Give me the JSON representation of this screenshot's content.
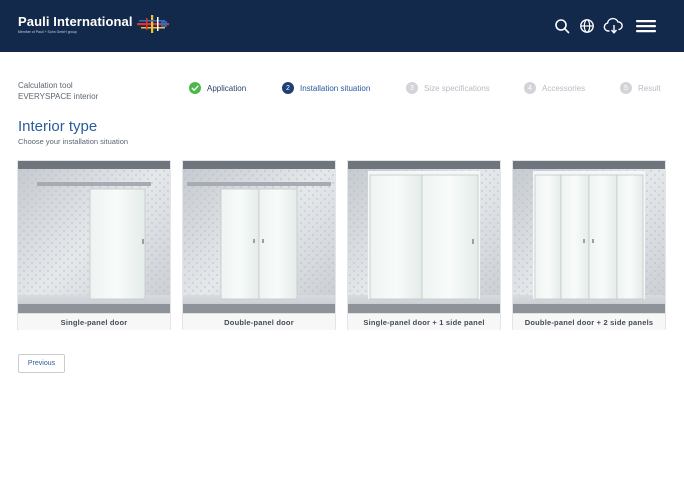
{
  "brand": {
    "name": "Pauli International",
    "tagline": "Member of Pauli + Sohn GmbH group",
    "header_bg": "#13294b"
  },
  "header_icons": [
    {
      "name": "search-icon"
    },
    {
      "name": "globe-icon"
    },
    {
      "name": "cloud-download-icon"
    },
    {
      "name": "menu-icon"
    }
  ],
  "calculation": {
    "line1": "Calculation tool",
    "line2": "EVERYSPACE interior"
  },
  "steps": [
    {
      "number": "✓",
      "label": "Application",
      "state": "done"
    },
    {
      "number": "2",
      "label": "Installation situation",
      "state": "active"
    },
    {
      "number": "3",
      "label": "Size specifications",
      "state": "future"
    },
    {
      "number": "4",
      "label": "Accessories",
      "state": "future"
    },
    {
      "number": "5",
      "label": "Result",
      "state": "future"
    }
  ],
  "page": {
    "title": "Interior type",
    "subtitle": "Choose your installation situation"
  },
  "options": [
    {
      "label": "Single-panel door"
    },
    {
      "label": "Double-panel door"
    },
    {
      "label": "Single-panel door + 1 side panel"
    },
    {
      "label": "Double-panel door + 2 side panels"
    }
  ],
  "nav": {
    "previous_label": "Previous"
  },
  "colors": {
    "accent": "#2b5c9c",
    "done": "#4bb84a",
    "active": "#1e3f75",
    "inactive": "#d2d4d8"
  }
}
